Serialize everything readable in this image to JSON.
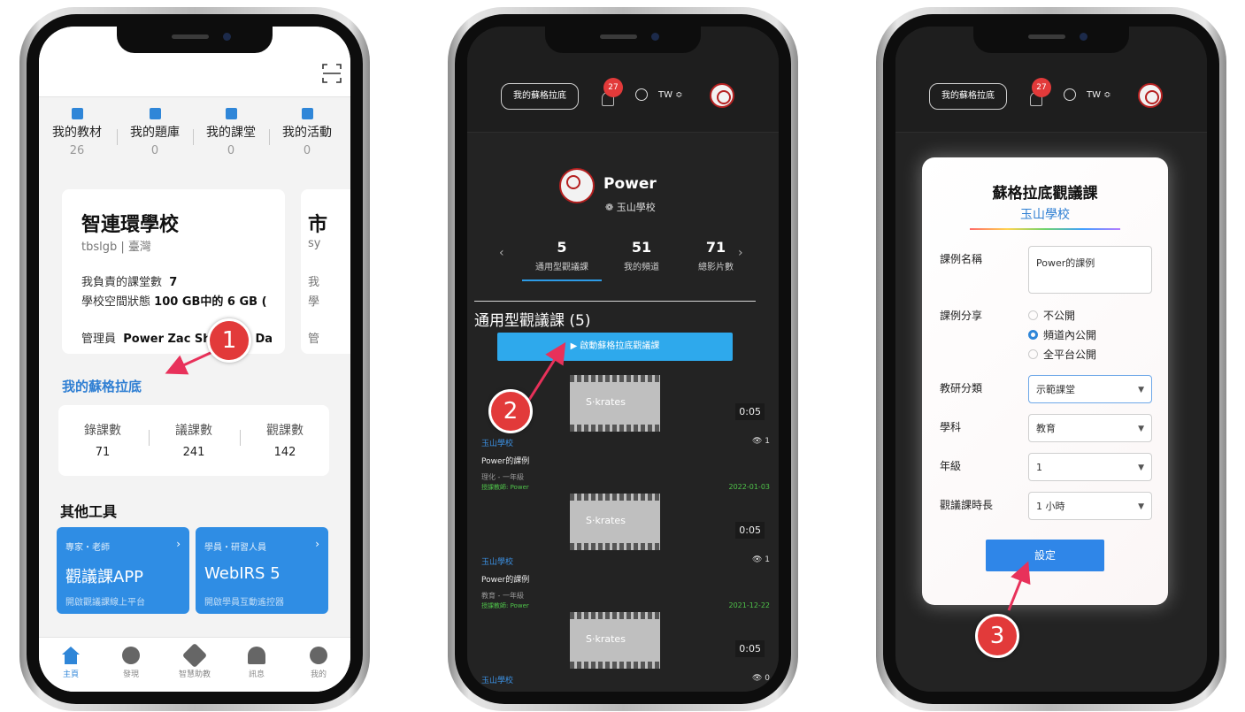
{
  "phone1": {
    "stats": [
      {
        "label": "我的教材",
        "value": "26"
      },
      {
        "label": "我的題庫",
        "value": "0"
      },
      {
        "label": "我的課堂",
        "value": "0"
      },
      {
        "label": "我的活動",
        "value": "0"
      }
    ],
    "school": {
      "name": "智連環學校",
      "sub": "tbslgb | 臺灣",
      "classes_label": "我負責的課堂數",
      "classes_value": "7",
      "space_label": "學校空間狀態",
      "space_value": "100 GB中的 6 GB (",
      "admin_label": "管理員",
      "admin_value": "Power Zac Shi Bella Da"
    },
    "school2": {
      "name": "市",
      "sub": "sy",
      "line1": "我",
      "line2": "學",
      "line3": "管"
    },
    "my_socrates": "我的蘇格拉底",
    "stats3": [
      {
        "label": "錄課數",
        "value": "71"
      },
      {
        "label": "議課數",
        "value": "241"
      },
      {
        "label": "觀課數",
        "value": "142"
      }
    ],
    "tools_title": "其他工具",
    "tools": [
      {
        "tag": "專家・老師",
        "title": "觀議課APP",
        "desc": "開啟觀議課線上平台"
      },
      {
        "tag": "學員・研習人員",
        "title": "WebIRS 5",
        "desc": "開啟學員互動遙控器"
      }
    ],
    "tabs": [
      "主頁",
      "發現",
      "智慧助教",
      "訊息",
      "我的"
    ]
  },
  "phone2": {
    "header": {
      "button": "我的蘇格拉底",
      "badge": "27",
      "lang": "TW ≎"
    },
    "profile": {
      "name": "Power",
      "school": "❁ 玉山學校"
    },
    "stats": [
      {
        "value": "5",
        "label": "通用型觀議課"
      },
      {
        "value": "51",
        "label": "我的頻道"
      },
      {
        "value": "71",
        "label": "總影片數"
      }
    ],
    "section_title": "通用型觀議課 (5)",
    "start_button": "▶ 啟動蘇格拉底觀議課",
    "videos": [
      {
        "brand": "S·krates",
        "duration": "0:05",
        "school": "玉山學校",
        "views": "👁 1",
        "title": "Power的課例",
        "meta": "理化 - 一年級",
        "teacher": "授課教師: Power",
        "date": "2022-01-03"
      },
      {
        "brand": "S·krates",
        "duration": "0:05",
        "school": "玉山學校",
        "views": "👁 1",
        "title": "Power的課例",
        "meta": "教育 - 一年級",
        "teacher": "授課教師: Power",
        "date": "2021-12-22"
      },
      {
        "brand": "S·krates",
        "duration": "0:05",
        "school": "玉山學校",
        "views": "👁 0"
      }
    ]
  },
  "phone3": {
    "header": {
      "button": "我的蘇格拉底",
      "badge": "27",
      "lang": "TW ≎"
    },
    "modal": {
      "title": "蘇格拉底觀議課",
      "subtitle": "玉山學校",
      "name_label": "課例名稱",
      "name_value": "Power的課例",
      "share_label": "課例分享",
      "share_options": [
        "不公開",
        "頻道內公開",
        "全平台公開"
      ],
      "share_selected": "頻道內公開",
      "category_label": "教研分類",
      "category_value": "示範課堂",
      "subject_label": "學科",
      "subject_value": "教育",
      "grade_label": "年級",
      "grade_value": "1",
      "duration_label": "觀議課時長",
      "duration_value": "1 小時",
      "submit": "設定"
    }
  },
  "steps": [
    "1",
    "2",
    "3"
  ],
  "colors": {
    "accent": "#2f86d8",
    "step": "#e23a3a",
    "dark_bg": "#232323"
  }
}
